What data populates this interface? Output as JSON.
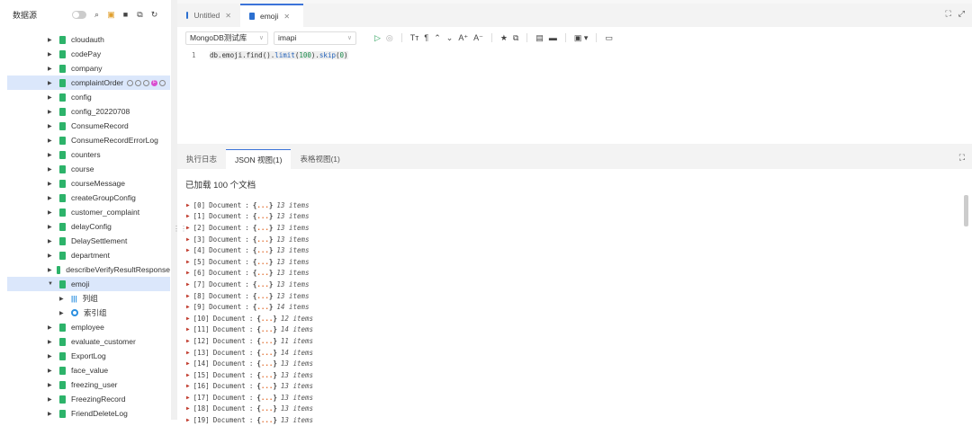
{
  "sidebar": {
    "title": "数据源",
    "items": [
      {
        "label": "cloudauth"
      },
      {
        "label": "codePay"
      },
      {
        "label": "company"
      },
      {
        "label": "complaintOrder",
        "selected": true
      },
      {
        "label": "config"
      },
      {
        "label": "config_20220708"
      },
      {
        "label": "ConsumeRecord"
      },
      {
        "label": "ConsumeRecordErrorLog"
      },
      {
        "label": "counters"
      },
      {
        "label": "course"
      },
      {
        "label": "courseMessage"
      },
      {
        "label": "createGroupConfig"
      },
      {
        "label": "customer_complaint"
      },
      {
        "label": "delayConfig"
      },
      {
        "label": "DelaySettlement"
      },
      {
        "label": "department"
      },
      {
        "label": "describeVerifyResultResponse"
      },
      {
        "label": "emoji",
        "expanded": true
      },
      {
        "label": "列组",
        "child": true,
        "icon": "columns-icon"
      },
      {
        "label": "索引组",
        "child": true,
        "icon": "index-icon"
      },
      {
        "label": "employee"
      },
      {
        "label": "evaluate_customer"
      },
      {
        "label": "ExportLog"
      },
      {
        "label": "face_value"
      },
      {
        "label": "freezing_user"
      },
      {
        "label": "FreezingRecord"
      },
      {
        "label": "FriendDeleteLog"
      }
    ]
  },
  "tabs": [
    {
      "label": "Untitled"
    },
    {
      "label": "emoji",
      "active": true
    }
  ],
  "toolbar": {
    "database": "MongoDB测试库",
    "collection": "imapi"
  },
  "editor": {
    "line": "1",
    "code_prefix": "db.emoji.find().",
    "fn1": "limit",
    "arg1": "100",
    "fn2": "skip",
    "arg2": "0"
  },
  "results": {
    "tabs": [
      "执行日志",
      "JSON 视图(1)",
      "表格视图(1)"
    ],
    "active_tab": 1,
    "loaded_text": "已加载 100 个文档",
    "documents": [
      {
        "i": "[0]",
        "n": "13 items"
      },
      {
        "i": "[1]",
        "n": "13 items"
      },
      {
        "i": "[2]",
        "n": "13 items"
      },
      {
        "i": "[3]",
        "n": "13 items"
      },
      {
        "i": "[4]",
        "n": "13 items"
      },
      {
        "i": "[5]",
        "n": "13 items"
      },
      {
        "i": "[6]",
        "n": "13 items"
      },
      {
        "i": "[7]",
        "n": "13 items"
      },
      {
        "i": "[8]",
        "n": "13 items"
      },
      {
        "i": "[9]",
        "n": "14 items"
      },
      {
        "i": "[10]",
        "n": "12 items"
      },
      {
        "i": "[11]",
        "n": "14 items"
      },
      {
        "i": "[12]",
        "n": "11 items"
      },
      {
        "i": "[13]",
        "n": "14 items"
      },
      {
        "i": "[14]",
        "n": "13 items"
      },
      {
        "i": "[15]",
        "n": "13 items"
      },
      {
        "i": "[16]",
        "n": "13 items"
      },
      {
        "i": "[17]",
        "n": "13 items"
      },
      {
        "i": "[18]",
        "n": "13 items"
      },
      {
        "i": "[19]",
        "n": "13 items"
      }
    ],
    "doc_label": "Document",
    "doc_sep": ":",
    "doc_braces_open": "{",
    "doc_dots": "...",
    "doc_braces_close": "}"
  },
  "colors": {
    "accent": "#3b73d9",
    "selected_row": "#dbe7fb",
    "collection_icon": "#2db36a"
  }
}
